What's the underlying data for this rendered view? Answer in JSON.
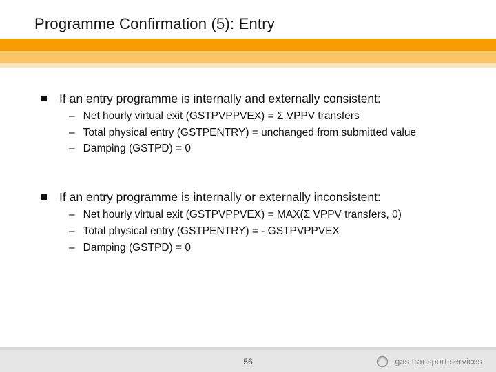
{
  "slide": {
    "title": "Programme Confirmation (5): Entry",
    "page_number": "56"
  },
  "sections": [
    {
      "heading": "If an entry programme is internally and externally consistent:",
      "items": [
        "Net hourly virtual exit (GSTPVPPVEX) = Σ VPPV transfers",
        "Total physical entry (GSTPENTRY) = unchanged from submitted value",
        "Damping (GSTPD) = 0"
      ]
    },
    {
      "heading": "If an entry programme is internally or externally inconsistent:",
      "items": [
        "Net hourly virtual exit (GSTPVPPVEX) = MAX(Σ VPPV transfers, 0)",
        "Total physical entry (GSTPENTRY) = - GSTPVPPVEX",
        "Damping (GSTPD) = 0"
      ]
    }
  ],
  "brand": {
    "name": "gas transport services"
  }
}
